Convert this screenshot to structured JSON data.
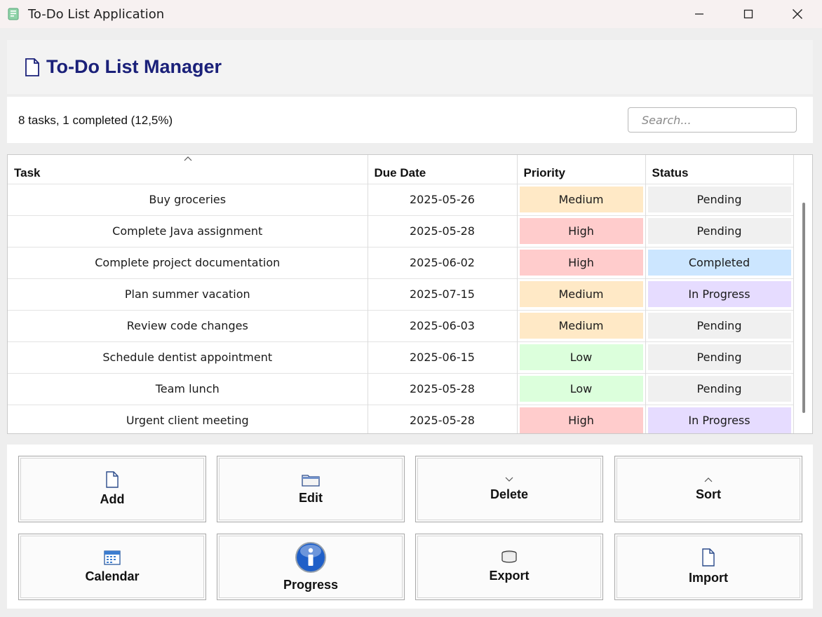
{
  "window": {
    "title": "To-Do List Application"
  },
  "header": {
    "title": "To-Do List Manager"
  },
  "infobar": {
    "summary": "8 tasks, 1 completed (12,5%)",
    "search_placeholder": "Search...",
    "search_value": ""
  },
  "table": {
    "columns": [
      "Task",
      "Due Date",
      "Priority",
      "Status"
    ],
    "sorted_column": "Task",
    "rows": [
      {
        "task": "Buy groceries",
        "due": "2025-05-26",
        "priority": "Medium",
        "status": "Pending"
      },
      {
        "task": "Complete Java assignment",
        "due": "2025-05-28",
        "priority": "High",
        "status": "Pending"
      },
      {
        "task": "Complete project documentation",
        "due": "2025-06-02",
        "priority": "High",
        "status": "Completed"
      },
      {
        "task": "Plan summer vacation",
        "due": "2025-07-15",
        "priority": "Medium",
        "status": "In Progress"
      },
      {
        "task": "Review code changes",
        "due": "2025-06-03",
        "priority": "Medium",
        "status": "Pending"
      },
      {
        "task": "Schedule dentist appointment",
        "due": "2025-06-15",
        "priority": "Low",
        "status": "Pending"
      },
      {
        "task": "Team lunch",
        "due": "2025-05-28",
        "priority": "Low",
        "status": "Pending"
      },
      {
        "task": "Urgent client meeting",
        "due": "2025-05-28",
        "priority": "High",
        "status": "In Progress"
      }
    ]
  },
  "colors": {
    "title_accent": "#1a2079",
    "priority": {
      "High": "#ffcccc",
      "Medium": "#ffe9c6",
      "Low": "#dcffdc"
    },
    "status": {
      "Pending": "#f0f0f0",
      "Completed": "#cce6ff",
      "In Progress": "#e6dcff"
    }
  },
  "actions": {
    "add": {
      "label": "Add",
      "icon": "file-icon"
    },
    "edit": {
      "label": "Edit",
      "icon": "folder-icon"
    },
    "delete": {
      "label": "Delete",
      "icon": "chevron-down-icon"
    },
    "sort": {
      "label": "Sort",
      "icon": "chevron-up-icon"
    },
    "calendar": {
      "label": "Calendar",
      "icon": "calendar-icon"
    },
    "progress": {
      "label": "Progress",
      "icon": "info-icon"
    },
    "export": {
      "label": "Export",
      "icon": "database-icon"
    },
    "import": {
      "label": "Import",
      "icon": "file-icon"
    }
  }
}
